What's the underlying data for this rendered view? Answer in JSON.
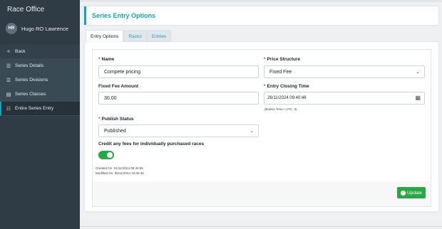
{
  "sidebar": {
    "app_title": "Race Office",
    "user": {
      "initials": "HR",
      "name": "Hugo RO Lawrence"
    },
    "items": [
      {
        "label": "Back",
        "icon": "double-chevron-left-icon"
      },
      {
        "label": "Series Details",
        "icon": "list-icon"
      },
      {
        "label": "Series Divisions",
        "icon": "list-icon"
      },
      {
        "label": "Series Classes",
        "icon": "table-list-icon"
      },
      {
        "label": "Entire Series Entry",
        "icon": "list-check-icon",
        "active": true
      }
    ]
  },
  "header": {
    "title": "Series Entry Options"
  },
  "tabs": [
    {
      "label": "Entry Options",
      "active": true
    },
    {
      "label": "Races"
    },
    {
      "label": "Entries"
    }
  ],
  "form": {
    "name": {
      "label": "Name",
      "value": "Compete pricing"
    },
    "price_structure": {
      "label": "Price Structure",
      "value": "Fixed Fee"
    },
    "fixed_fee_amount": {
      "label": "Fixed Fee Amount",
      "value": "30.00"
    },
    "entry_closing_time": {
      "label": "Entry Closing Time",
      "value": "26/11/2024 09:40:46",
      "hint": "(Bolivia Time / UTC -4)"
    },
    "publish_status": {
      "label": "Publish Status",
      "value": "Published"
    },
    "credit_fees": {
      "label": "Credit any fees for individually purchased races",
      "enabled": true
    },
    "created_on": "Created On: 01/11/2024 09:40:55",
    "modified_on": "Modified On: 05/11/2024 10:08:46"
  },
  "actions": {
    "update_label": "Update"
  },
  "colors": {
    "accent": "#17a2b8",
    "success": "#28a745",
    "sidebar": "#2f3b45",
    "required": "#dc3545"
  }
}
